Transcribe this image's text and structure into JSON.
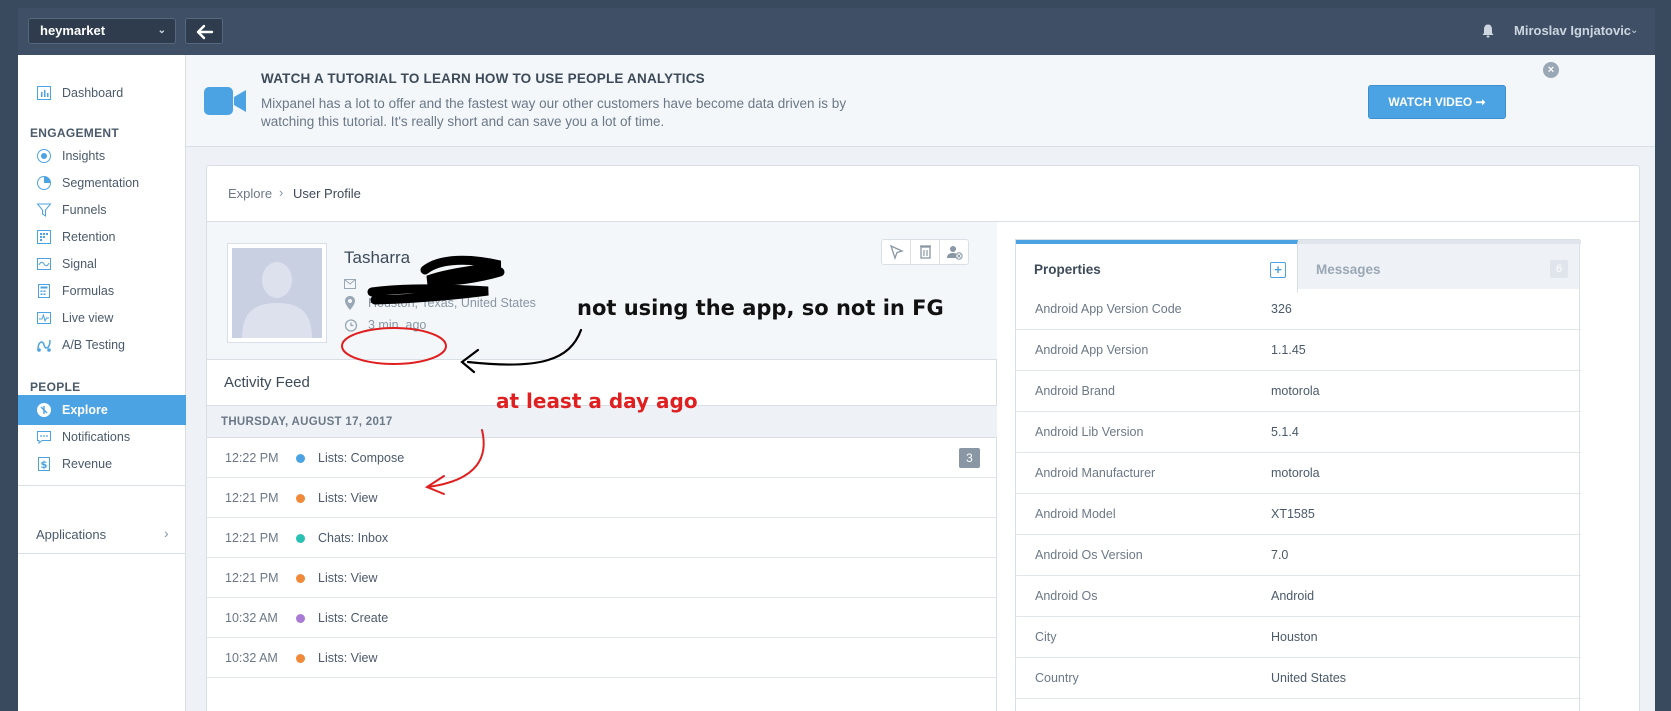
{
  "topbar": {
    "project": "heymarket",
    "user_name": "Miroslav Ignjatovic"
  },
  "sidebar": {
    "dashboard": "Dashboard",
    "engagement_heading": "ENGAGEMENT",
    "engagement_items": [
      "Insights",
      "Segmentation",
      "Funnels",
      "Retention",
      "Signal",
      "Formulas",
      "Live view",
      "A/B Testing"
    ],
    "people_heading": "PEOPLE",
    "people_items": [
      "Explore",
      "Notifications",
      "Revenue"
    ],
    "applications": "Applications"
  },
  "banner": {
    "title": "WATCH A TUTORIAL TO LEARN HOW TO USE PEOPLE ANALYTICS",
    "line1": "Mixpanel has a lot to offer and the fastest way our other customers have become data driven is by",
    "line2": "watching this tutorial. It's really short and can save you a lot of time.",
    "button": "WATCH VIDEO"
  },
  "breadcrumb": {
    "root": "Explore",
    "current": "User Profile"
  },
  "profile": {
    "name": "Tasharra",
    "location": "Houston, Texas, United States",
    "last_seen": "3 min. ago"
  },
  "activity": {
    "title": "Activity Feed",
    "date": "THURSDAY, AUGUST 17, 2017",
    "events": [
      {
        "time": "12:22 PM",
        "name": "Lists: Compose",
        "color": "#4ba3e3",
        "count": "3"
      },
      {
        "time": "12:21 PM",
        "name": "Lists: View",
        "color": "#f08a3a"
      },
      {
        "time": "12:21 PM",
        "name": "Chats: Inbox",
        "color": "#2bc0b4"
      },
      {
        "time": "12:21 PM",
        "name": "Lists: View",
        "color": "#f08a3a"
      },
      {
        "time": "10:32 AM",
        "name": "Lists: Create",
        "color": "#a97bd6"
      },
      {
        "time": "10:32 AM",
        "name": "Lists: View",
        "color": "#f08a3a"
      }
    ]
  },
  "tabs": {
    "properties": "Properties",
    "messages": "Messages",
    "messages_count": "6"
  },
  "properties": [
    {
      "key": "Android App Version Code",
      "value": "326"
    },
    {
      "key": "Android App Version",
      "value": "1.1.45"
    },
    {
      "key": "Android Brand",
      "value": "motorola"
    },
    {
      "key": "Android Lib Version",
      "value": "5.1.4"
    },
    {
      "key": "Android Manufacturer",
      "value": "motorola"
    },
    {
      "key": "Android Model",
      "value": "XT1585"
    },
    {
      "key": "Android Os Version",
      "value": "7.0"
    },
    {
      "key": "Android Os",
      "value": "Android"
    },
    {
      "key": "City",
      "value": "Houston"
    },
    {
      "key": "Country",
      "value": "United States"
    }
  ],
  "annotations": {
    "note1": "not using the app, so not in FG",
    "note2": "at least a day ago"
  },
  "colors": {
    "accent": "#4ba3e3",
    "topbar": "#3f5066",
    "annotation_red": "#e02020"
  }
}
